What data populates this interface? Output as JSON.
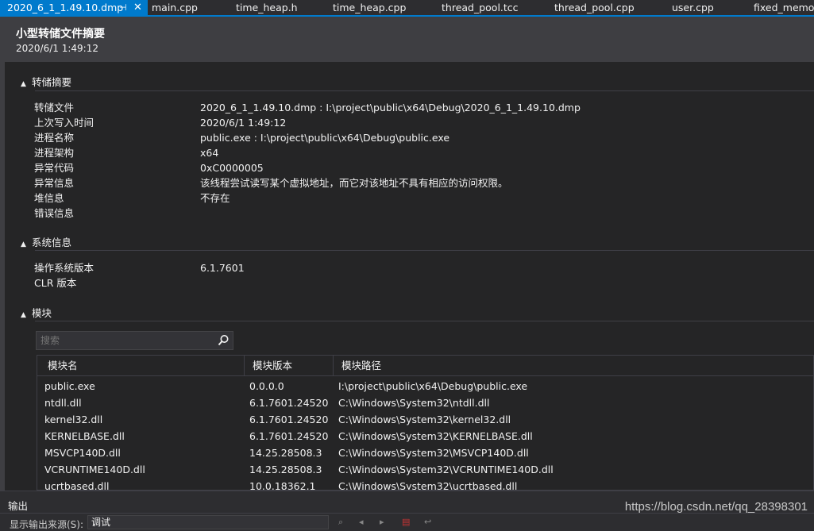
{
  "tabs": {
    "active": {
      "label": "2020_6_1_1.49.10.dmp",
      "pin_glyph": "⊣",
      "close_glyph": "✕"
    },
    "others": [
      {
        "label": "main.cpp"
      },
      {
        "label": "time_heap.h"
      },
      {
        "label": "time_heap.cpp"
      },
      {
        "label": "thread_pool.tcc"
      },
      {
        "label": "thread_pool.cpp"
      },
      {
        "label": "user.cpp"
      },
      {
        "label": "fixed_memory"
      }
    ]
  },
  "header": {
    "title": "小型转储文件摘要",
    "date": "2020/6/1 1:49:12"
  },
  "sections": {
    "dump": {
      "title": "转储摘要",
      "rows": [
        {
          "key": "转储文件",
          "value": "2020_6_1_1.49.10.dmp : I:\\project\\public\\x64\\Debug\\2020_6_1_1.49.10.dmp"
        },
        {
          "key": "上次写入时间",
          "value": "2020/6/1 1:49:12"
        },
        {
          "key": "进程名称",
          "value": "public.exe : I:\\project\\public\\x64\\Debug\\public.exe"
        },
        {
          "key": "进程架构",
          "value": "x64"
        },
        {
          "key": "异常代码",
          "value": "0xC0000005"
        },
        {
          "key": "异常信息",
          "value": "该线程尝试读写某个虚拟地址，而它对该地址不具有相应的访问权限。"
        },
        {
          "key": "堆信息",
          "value": "不存在"
        },
        {
          "key": "错误信息",
          "value": ""
        }
      ]
    },
    "system": {
      "title": "系统信息",
      "rows": [
        {
          "key": "操作系统版本",
          "value": "6.1.7601"
        },
        {
          "key": "CLR 版本",
          "value": ""
        }
      ]
    },
    "modules": {
      "title": "模块",
      "search_placeholder": "搜索",
      "columns": [
        "模块名",
        "模块版本",
        "模块路径"
      ],
      "rows": [
        {
          "name": "public.exe",
          "version": "0.0.0.0",
          "path": "I:\\project\\public\\x64\\Debug\\public.exe"
        },
        {
          "name": "ntdll.dll",
          "version": "6.1.7601.24520",
          "path": "C:\\Windows\\System32\\ntdll.dll"
        },
        {
          "name": "kernel32.dll",
          "version": "6.1.7601.24520",
          "path": "C:\\Windows\\System32\\kernel32.dll"
        },
        {
          "name": "KERNELBASE.dll",
          "version": "6.1.7601.24520",
          "path": "C:\\Windows\\System32\\KERNELBASE.dll"
        },
        {
          "name": "MSVCP140D.dll",
          "version": "14.25.28508.3",
          "path": "C:\\Windows\\System32\\MSVCP140D.dll"
        },
        {
          "name": "VCRUNTIME140D.dll",
          "version": "14.25.28508.3",
          "path": "C:\\Windows\\System32\\VCRUNTIME140D.dll"
        },
        {
          "name": "ucrtbased.dll",
          "version": "10.0.18362.1",
          "path": "C:\\Windows\\System32\\ucrtbased.dll"
        }
      ]
    }
  },
  "output": {
    "title": "输出",
    "source_label": "显示输出来源(S):",
    "source_value": "调试"
  },
  "watermark": "https://blog.csdn.net/qq_28398301",
  "colors": {
    "accent": "#007acc",
    "background": "#252526",
    "header": "#3e3e42"
  }
}
